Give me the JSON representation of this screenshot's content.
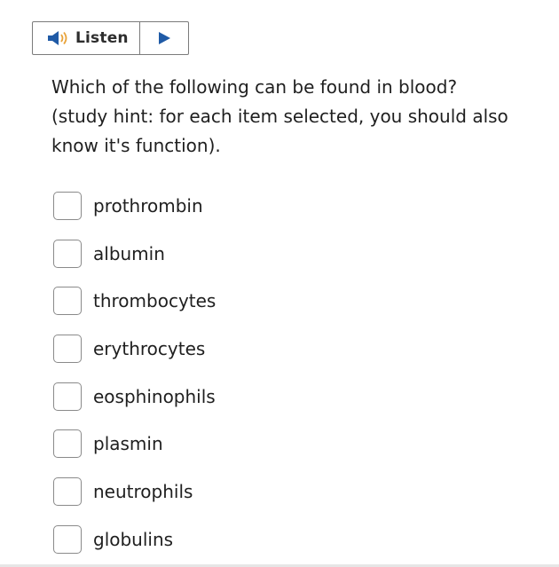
{
  "listen": {
    "label": "Listen",
    "speaker_icon": "speaker-icon",
    "play_icon": "play-icon",
    "accent_color": "#1f5aa6"
  },
  "question": {
    "prompt": "Which of the following can be found in blood?",
    "hint": "(study hint: for each item selected, you should also know it's function)."
  },
  "options": [
    {
      "label": "prothrombin",
      "checked": false
    },
    {
      "label": "albumin",
      "checked": false
    },
    {
      "label": "thrombocytes",
      "checked": false
    },
    {
      "label": "erythrocytes",
      "checked": false
    },
    {
      "label": "eosphinophils",
      "checked": false
    },
    {
      "label": "plasmin",
      "checked": false
    },
    {
      "label": "neutrophils",
      "checked": false
    },
    {
      "label": "globulins",
      "checked": false
    }
  ]
}
